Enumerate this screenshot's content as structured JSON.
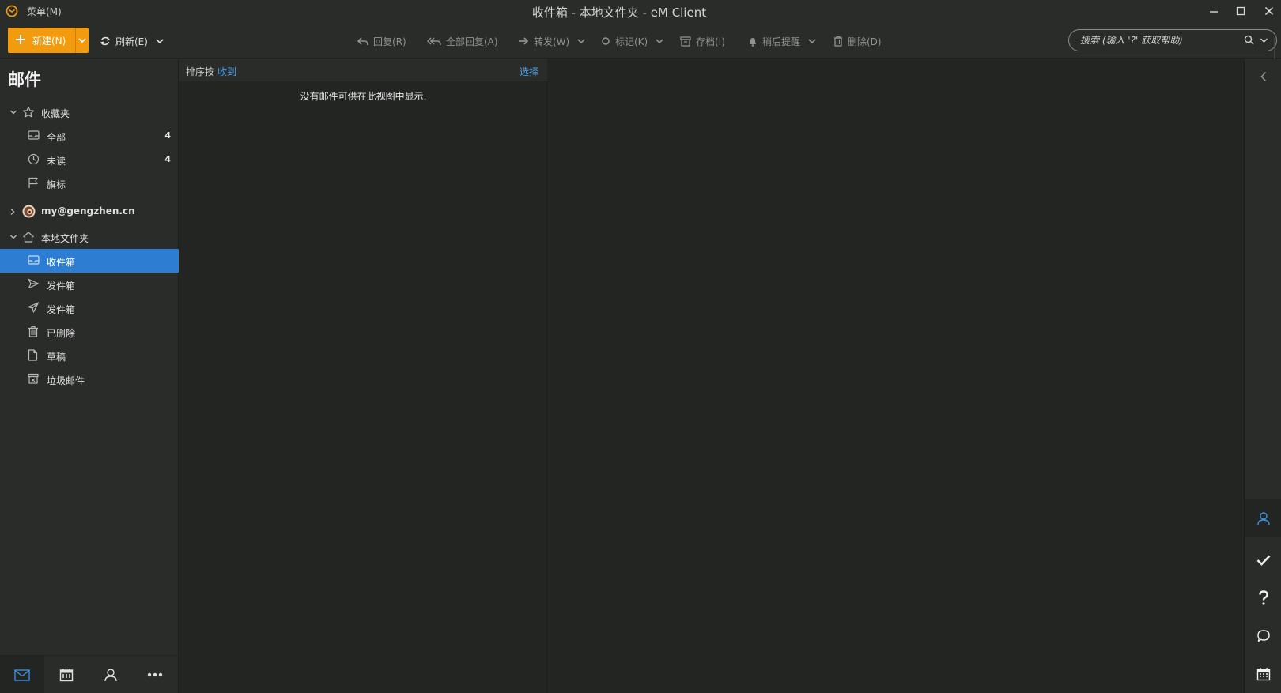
{
  "window": {
    "menu_label": "菜单(M)",
    "title": "收件箱 - 本地文件夹 - eM Client"
  },
  "toolbar": {
    "new_label": "新建(N)",
    "refresh_label": "刷新(E)",
    "reply_label": "回复(R)",
    "reply_all_label": "全部回复(A)",
    "forward_label": "转发(W)",
    "mark_label": "标记(K)",
    "archive_label": "存档(I)",
    "snooze_label": "稍后提醒",
    "delete_label": "删除(D)",
    "search_placeholder": "搜索 (输入 '?' 获取帮助)"
  },
  "sidebar": {
    "title": "邮件",
    "favorites": {
      "label": "收藏夹",
      "items": [
        {
          "label": "全部",
          "count": "4",
          "icon": "inbox-icon"
        },
        {
          "label": "未读",
          "count": "4",
          "icon": "clock-icon"
        },
        {
          "label": "旗标",
          "count": "",
          "icon": "flag-icon"
        }
      ]
    },
    "account": {
      "label": "my@gengzhen.cn"
    },
    "local_folders": {
      "label": "本地文件夹",
      "items": [
        {
          "label": "收件箱",
          "icon": "inbox-icon",
          "selected": true
        },
        {
          "label": "发件箱",
          "icon": "outbox-icon"
        },
        {
          "label": "发件箱",
          "icon": "sent-icon"
        },
        {
          "label": "已删除",
          "icon": "trash-icon"
        },
        {
          "label": "草稿",
          "icon": "draft-icon"
        },
        {
          "label": "垃圾邮件",
          "icon": "junk-icon"
        }
      ]
    }
  },
  "message_list": {
    "sort_prefix": "排序按",
    "sort_value": "收到",
    "select_label": "选择",
    "empty_text": "没有邮件可供在此视图中显示."
  },
  "colors": {
    "accent": "#f39b0f",
    "selection": "#2d7dd2",
    "link": "#4a9de6",
    "background": "#232523",
    "panel": "#2a2c2a"
  }
}
